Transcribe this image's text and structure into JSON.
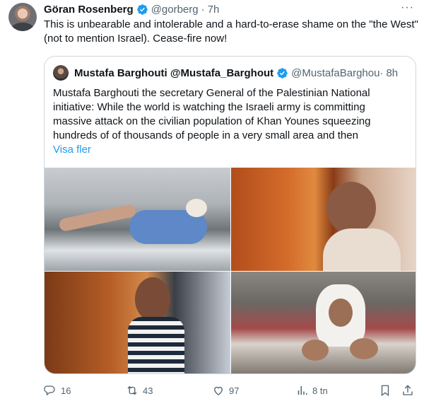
{
  "tweet": {
    "author_name": "Göran Rosenberg",
    "author_handle": "@gorberg",
    "separator": "·",
    "time": "7h",
    "more": "···",
    "text": "This is unbearable and intolerable and a hard-to-erase shame on the \"the West\" (not to mention Israel). Cease-fire now!"
  },
  "quote": {
    "author_name": "Mustafa Barghouti @Mustafa_Barghout",
    "author_handle": "@MustafaBarghou·",
    "separator": "·",
    "time": "8h",
    "text": "Mustafa Barghouti the secretary General of the Palestinian National initiative: While the world is watching the Israeli army is committing massive attack  on the civilian population of Khan Younes squeezing hundreds of of thousands of people in a very small area and then",
    "show_more": "Visa fler"
  },
  "actions": {
    "replies": "16",
    "retweets": "43",
    "likes": "97",
    "views": "8 tn"
  },
  "colors": {
    "link": "#1d9bf0",
    "secondary_text": "#536471",
    "verified": "#1d9bf0"
  },
  "icons": [
    "verified-badge-icon",
    "more-icon",
    "reply-icon",
    "retweet-icon",
    "like-icon",
    "views-icon",
    "bookmark-icon",
    "share-icon"
  ]
}
